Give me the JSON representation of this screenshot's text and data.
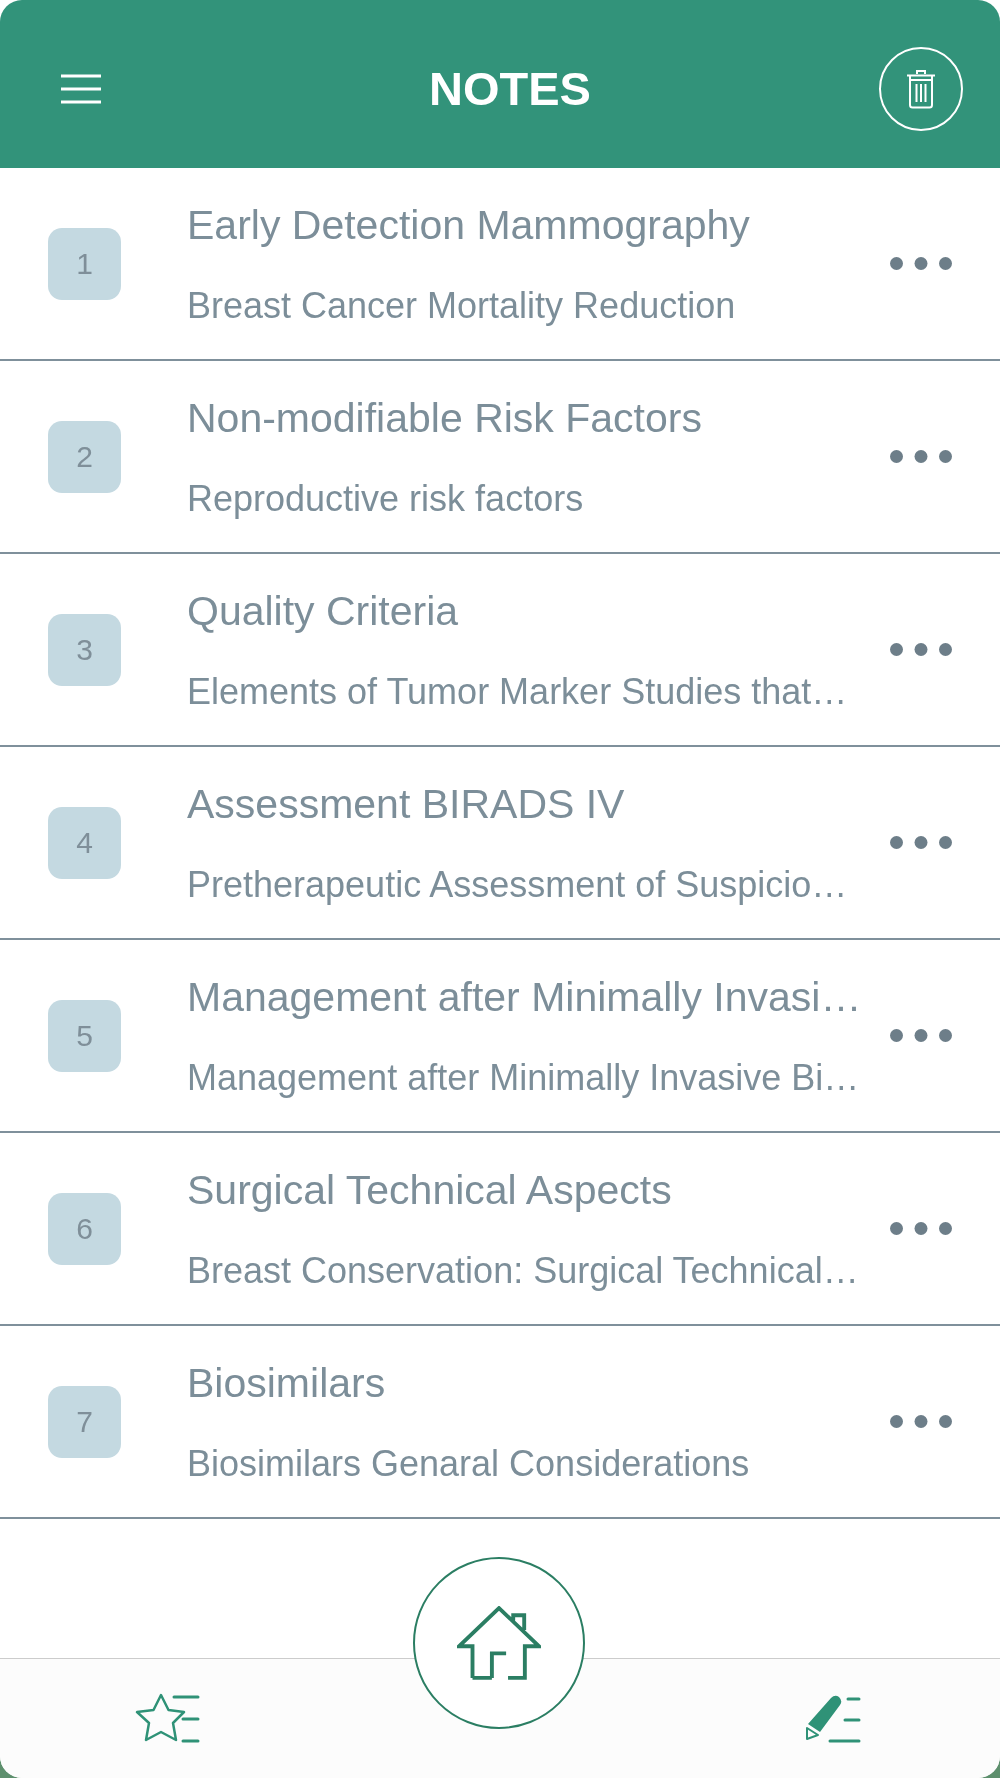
{
  "header": {
    "title": "NOTES"
  },
  "notes": [
    {
      "number": "1",
      "title": "Early Detection Mammography",
      "subtitle": "Breast Cancer Mortality Reduction"
    },
    {
      "number": "2",
      "title": "Non-modifiable Risk Factors",
      "subtitle": "Reproductive risk factors"
    },
    {
      "number": "3",
      "title": "Quality Criteria",
      "subtitle": "Elements of Tumor Marker Studies that…"
    },
    {
      "number": "4",
      "title": "Assessment BIRADS IV",
      "subtitle": "Pretherapeutic Assessment of Suspicio…"
    },
    {
      "number": "5",
      "title": "Management after Minimally Invasi…",
      "subtitle": "Management after Minimally Invasive Bi…"
    },
    {
      "number": "6",
      "title": "Surgical Technical Aspects",
      "subtitle": "Breast Conservation: Surgical Technical…"
    },
    {
      "number": "7",
      "title": "Biosimilars",
      "subtitle": "Biosimilars Genaral Considerations"
    }
  ]
}
